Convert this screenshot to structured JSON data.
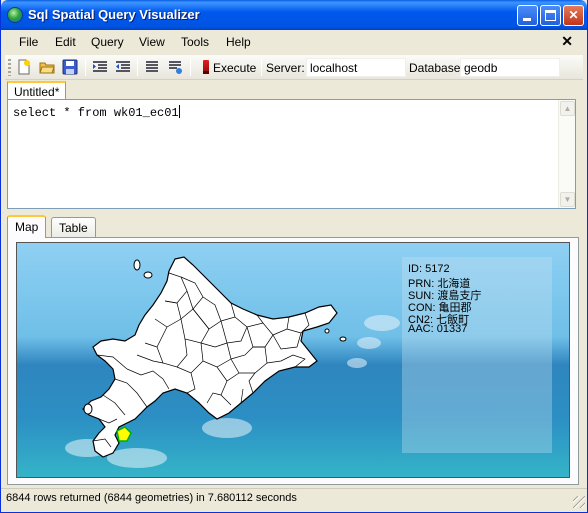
{
  "window": {
    "title": "Sql Spatial Query Visualizer",
    "controls": {
      "minimize": "minimize",
      "maximize": "maximize",
      "close": "✕"
    }
  },
  "menu": {
    "items": [
      {
        "label": "File"
      },
      {
        "label": "Edit"
      },
      {
        "label": "Query"
      },
      {
        "label": "View"
      },
      {
        "label": "Tools"
      },
      {
        "label": "Help"
      }
    ],
    "close": "✕"
  },
  "toolbar": {
    "execute_label": "Execute",
    "server_label": "Server:",
    "server_value": "localhost",
    "database_label": "Database",
    "database_value": "geodb",
    "icons": [
      "new-file-icon",
      "open-folder-icon",
      "save-icon",
      "indent-icon",
      "outdent-icon",
      "align-icon",
      "clear-icon",
      "execute-icon"
    ]
  },
  "editor": {
    "tab_label": "Untitled*",
    "query": "select * from wk01_ec01"
  },
  "view_tabs": {
    "map": "Map",
    "table": "Table"
  },
  "info": {
    "id": "ID: 5172",
    "prn": "PRN: 北海道",
    "sun": "SUN: 渡島支庁",
    "con": "CON: 亀田郡",
    "cn2": "CN2: 七飯町",
    "aac": "AAC: 01337"
  },
  "status": {
    "message": "6844 rows returned (6844 geometries) in 7.680112 seconds"
  },
  "colors": {
    "titlebar": "#0054e3",
    "highlight_fill": "#ffff00",
    "highlight_outline": "#00b000",
    "land": "#ffffff",
    "sea": "#2c8fc4"
  }
}
